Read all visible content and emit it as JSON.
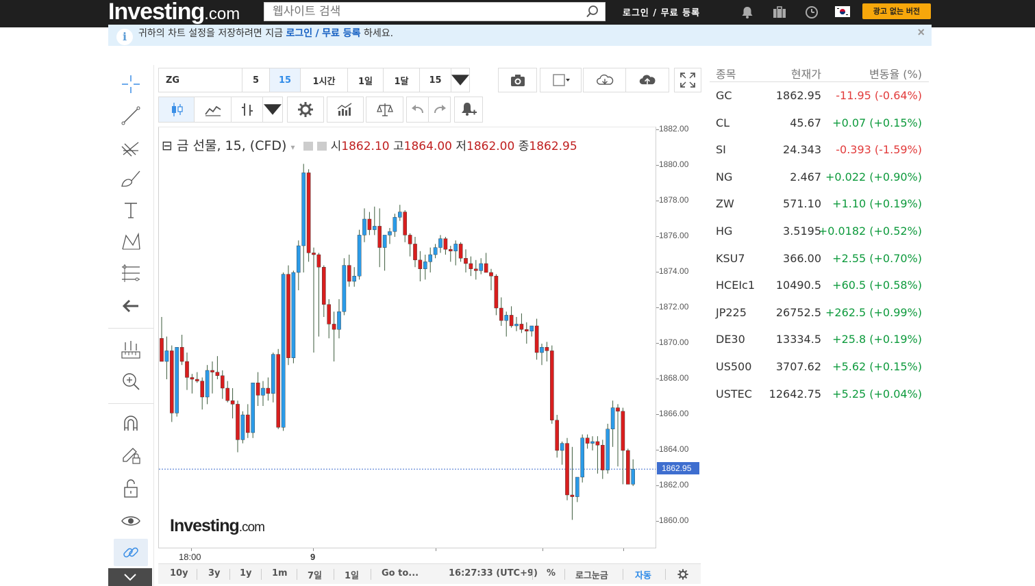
{
  "header": {
    "logo_main": "Investing",
    "logo_suffix": ".com",
    "search_placeholder": "웹사이트 검색",
    "login_label": "로그인",
    "auth_separator": "/",
    "register_label": "무료 등록",
    "adfree_label": "광고 없는 버전"
  },
  "notice": {
    "icon": "i",
    "text_before": "귀하의 차트 설정을 저장하려면 지금",
    "login_link": "로그인",
    "separator": "/",
    "register_link": "무료 등록",
    "text_after": "하세요.",
    "close": "×"
  },
  "toolbar": {
    "symbol": "ZG",
    "intervals": [
      "5",
      "15",
      "1시간",
      "1일",
      "1달",
      "15"
    ],
    "selected_interval": "15"
  },
  "legend": {
    "collapse": "⊟",
    "title": "금 선물, 15, (CFD)",
    "open_label": "시",
    "open": "1862.10",
    "high_label": "고",
    "high": "1864.00",
    "low_label": "저",
    "low": "1862.00",
    "close_label": "종",
    "close": "1862.95"
  },
  "watermark": {
    "main": "Investing",
    "suffix": ".com"
  },
  "bottombar": {
    "ranges": [
      "10y",
      "3y",
      "1y",
      "1m",
      "7일",
      "1일"
    ],
    "goto": "Go to...",
    "time": "16:27:33 (UTC+9)",
    "percent": "%",
    "log": "로그눈금",
    "auto": "자동"
  },
  "quotes": {
    "headers": {
      "symbol": "종목",
      "price": "현재가",
      "change": "변동율 (%)"
    },
    "rows": [
      {
        "symbol": "GC",
        "price": "1862.95",
        "change": "-11.95 (-0.64%)",
        "dir": "down"
      },
      {
        "symbol": "CL",
        "price": "45.67",
        "change": "+0.07 (+0.15%)",
        "dir": "up"
      },
      {
        "symbol": "SI",
        "price": "24.343",
        "change": "-0.393 (-1.59%)",
        "dir": "down"
      },
      {
        "symbol": "NG",
        "price": "2.467",
        "change": "+0.022 (+0.90%)",
        "dir": "up"
      },
      {
        "symbol": "ZW",
        "price": "571.10",
        "change": "+1.10 (+0.19%)",
        "dir": "up"
      },
      {
        "symbol": "HG",
        "price": "3.5195",
        "change": "+0.0182 (+0.52%)",
        "dir": "up"
      },
      {
        "symbol": "KSU7",
        "price": "366.00",
        "change": "+2.55 (+0.70%)",
        "dir": "up"
      },
      {
        "symbol": "HCEIc1",
        "price": "10490.5",
        "change": "+60.5 (+0.58%)",
        "dir": "up"
      },
      {
        "symbol": "JP225",
        "price": "26752.5",
        "change": "+262.5 (+0.99%)",
        "dir": "up"
      },
      {
        "symbol": "DE30",
        "price": "13334.5",
        "change": "+25.8 (+0.19%)",
        "dir": "up"
      },
      {
        "symbol": "US500",
        "price": "3707.62",
        "change": "+5.62 (+0.15%)",
        "dir": "up"
      },
      {
        "symbol": "USTEC",
        "price": "12642.75",
        "change": "+5.25 (+0.04%)",
        "dir": "up"
      }
    ]
  },
  "colors": {
    "up_candle": "#2b9be8",
    "down_candle": "#d81e1e",
    "wick": "#3a5a3a",
    "price_line": "#3e6ecf",
    "up_text": "#0d9a3c",
    "down_text": "#e23b3b",
    "accent": "#f7a70b"
  },
  "chart_data": {
    "type": "candlestick",
    "title": "금 선물, 15, (CFD)",
    "ylim": [
      1859.0,
      1882.0
    ],
    "yticks": [
      "1882.00",
      "1880.00",
      "1878.00",
      "1876.00",
      "1874.00",
      "1872.00",
      "1870.00",
      "1868.00",
      "1866.00",
      "1864.00",
      "1862.00",
      "1860.00"
    ],
    "last_price": "1862.95",
    "xticks": [
      "18:00",
      "9"
    ],
    "candles": [
      [
        1870.3,
        1871.5,
        1869.0,
        1869.0
      ],
      [
        1869.0,
        1870.4,
        1868.0,
        1869.6
      ],
      [
        1869.6,
        1869.9,
        1865.6,
        1866.1
      ],
      [
        1866.1,
        1869.8,
        1865.9,
        1869.8
      ],
      [
        1869.8,
        1870.5,
        1868.8,
        1869.0
      ],
      [
        1869.0,
        1869.5,
        1867.4,
        1868.1
      ],
      [
        1868.1,
        1868.3,
        1867.2,
        1868.0
      ],
      [
        1868.0,
        1868.4,
        1867.8,
        1867.9
      ],
      [
        1867.9,
        1868.1,
        1866.3,
        1867.0
      ],
      [
        1867.0,
        1868.8,
        1866.6,
        1868.5
      ],
      [
        1868.5,
        1869.0,
        1867.2,
        1868.4
      ],
      [
        1868.4,
        1869.3,
        1868.0,
        1868.2
      ],
      [
        1868.2,
        1868.5,
        1866.9,
        1867.5
      ],
      [
        1867.5,
        1867.9,
        1866.7,
        1866.8
      ],
      [
        1866.8,
        1867.5,
        1865.8,
        1866.6
      ],
      [
        1866.6,
        1866.8,
        1863.9,
        1864.6
      ],
      [
        1864.6,
        1866.2,
        1864.4,
        1866.0
      ],
      [
        1866.0,
        1866.6,
        1864.7,
        1865.0
      ],
      [
        1865.0,
        1867.8,
        1864.7,
        1867.8
      ],
      [
        1867.8,
        1868.4,
        1866.5,
        1867.1
      ],
      [
        1867.1,
        1867.9,
        1866.5,
        1867.5
      ],
      [
        1867.5,
        1868.1,
        1866.8,
        1867.2
      ],
      [
        1867.2,
        1869.5,
        1866.7,
        1869.4
      ],
      [
        1869.4,
        1869.7,
        1865.2,
        1865.3
      ],
      [
        1865.3,
        1874.0,
        1865.1,
        1873.9
      ],
      [
        1873.9,
        1874.4,
        1868.8,
        1869.2
      ],
      [
        1869.2,
        1874.1,
        1868.9,
        1874.0
      ],
      [
        1874.0,
        1875.8,
        1873.0,
        1875.5
      ],
      [
        1875.5,
        1880.1,
        1874.0,
        1879.6
      ],
      [
        1879.6,
        1879.8,
        1874.6,
        1875.1
      ],
      [
        1875.1,
        1875.4,
        1869.5,
        1875.0
      ],
      [
        1875.0,
        1875.1,
        1870.4,
        1874.3
      ],
      [
        1874.3,
        1874.4,
        1871.5,
        1872.2
      ],
      [
        1872.2,
        1872.5,
        1870.3,
        1871.1
      ],
      [
        1871.1,
        1871.8,
        1869.0,
        1870.8
      ],
      [
        1870.8,
        1872.5,
        1870.3,
        1871.8
      ],
      [
        1871.8,
        1874.8,
        1871.6,
        1874.4
      ],
      [
        1874.4,
        1875.0,
        1873.2,
        1873.5
      ],
      [
        1873.5,
        1874.3,
        1873.2,
        1873.8
      ],
      [
        1873.8,
        1876.4,
        1873.6,
        1876.1
      ],
      [
        1876.1,
        1877.6,
        1875.7,
        1877.0
      ],
      [
        1877.0,
        1877.4,
        1876.1,
        1876.4
      ],
      [
        1876.4,
        1877.7,
        1876.1,
        1876.6
      ],
      [
        1876.6,
        1877.6,
        1874.3,
        1875.4
      ],
      [
        1875.4,
        1875.7,
        1874.1,
        1876.1
      ],
      [
        1876.1,
        1876.5,
        1875.6,
        1876.3
      ],
      [
        1876.3,
        1877.3,
        1876.0,
        1877.1
      ],
      [
        1877.1,
        1877.8,
        1876.9,
        1877.4
      ],
      [
        1877.4,
        1877.5,
        1875.7,
        1876.1
      ],
      [
        1876.1,
        1876.2,
        1874.9,
        1875.6
      ],
      [
        1875.6,
        1876.0,
        1874.3,
        1874.7
      ],
      [
        1874.7,
        1875.2,
        1873.5,
        1874.2
      ],
      [
        1874.2,
        1875.0,
        1873.6,
        1874.6
      ],
      [
        1874.6,
        1875.4,
        1874.0,
        1875.0
      ],
      [
        1875.0,
        1875.6,
        1874.8,
        1875.4
      ],
      [
        1875.4,
        1876.1,
        1875.1,
        1875.9
      ],
      [
        1875.9,
        1876.0,
        1875.0,
        1875.3
      ],
      [
        1875.3,
        1875.5,
        1874.6,
        1875.2
      ],
      [
        1875.2,
        1875.8,
        1874.4,
        1875.6
      ],
      [
        1875.6,
        1875.7,
        1874.6,
        1874.8
      ],
      [
        1874.8,
        1875.3,
        1874.0,
        1874.5
      ],
      [
        1874.5,
        1874.9,
        1873.8,
        1874.2
      ],
      [
        1874.2,
        1874.7,
        1873.6,
        1874.1
      ],
      [
        1874.1,
        1874.8,
        1873.9,
        1874.5
      ],
      [
        1874.5,
        1875.1,
        1874.2,
        1874.0
      ],
      [
        1874.0,
        1874.2,
        1873.0,
        1873.8
      ],
      [
        1873.8,
        1873.9,
        1871.6,
        1872.0
      ],
      [
        1872.0,
        1872.6,
        1871.0,
        1871.3
      ],
      [
        1871.3,
        1871.8,
        1870.4,
        1871.6
      ],
      [
        1871.6,
        1872.1,
        1870.9,
        1871.0
      ],
      [
        1871.0,
        1871.5,
        1870.7,
        1871.1
      ],
      [
        1871.1,
        1871.7,
        1870.6,
        1870.8
      ],
      [
        1870.8,
        1871.2,
        1870.0,
        1870.7
      ],
      [
        1870.7,
        1871.0,
        1870.4,
        1871.0
      ],
      [
        1871.0,
        1871.4,
        1869.1,
        1869.5
      ],
      [
        1869.5,
        1870.0,
        1868.8,
        1869.8
      ],
      [
        1869.8,
        1870.1,
        1869.0,
        1869.6
      ],
      [
        1869.6,
        1869.9,
        1865.5,
        1865.7
      ],
      [
        1865.7,
        1866.0,
        1863.6,
        1864.0
      ],
      [
        1864.0,
        1864.5,
        1863.2,
        1864.4
      ],
      [
        1864.4,
        1864.7,
        1861.2,
        1861.5
      ],
      [
        1861.5,
        1864.2,
        1860.1,
        1861.4
      ],
      [
        1861.4,
        1862.0,
        1861.1,
        1862.5
      ],
      [
        1862.5,
        1864.9,
        1862.2,
        1864.7
      ],
      [
        1864.7,
        1864.9,
        1864.1,
        1864.4
      ],
      [
        1864.4,
        1864.8,
        1864.0,
        1864.5
      ],
      [
        1864.5,
        1864.8,
        1862.7,
        1864.3
      ],
      [
        1864.3,
        1864.6,
        1862.4,
        1862.9
      ],
      [
        1862.9,
        1865.5,
        1862.7,
        1865.2
      ],
      [
        1865.2,
        1866.8,
        1864.2,
        1866.4
      ],
      [
        1866.4,
        1866.6,
        1863.1,
        1866.2
      ],
      [
        1866.2,
        1866.4,
        1862.1,
        1864.0
      ],
      [
        1864.0,
        1864.1,
        1862.1,
        1862.1
      ],
      [
        1862.1,
        1863.5,
        1862.0,
        1862.95
      ]
    ]
  }
}
